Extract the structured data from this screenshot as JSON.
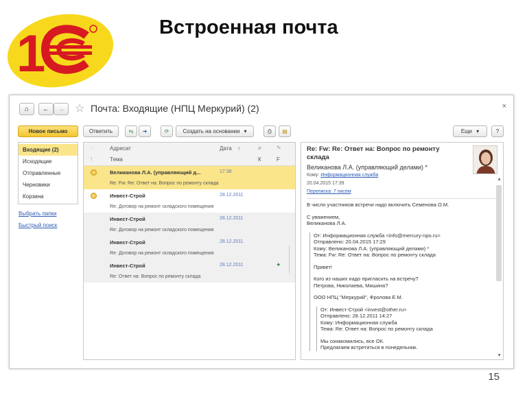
{
  "slide": {
    "title": "Встроенная почта",
    "page_number": "15"
  },
  "window": {
    "title": "Почта: Входящие (НПЦ Меркурий) (2)",
    "nav": [
      "⌂",
      "←",
      "→"
    ],
    "close": "×"
  },
  "toolbar": {
    "new_message": "Новое письмо",
    "reply": "Ответить",
    "create_based_on": "Создать на основании",
    "more": "Еще",
    "help": "?"
  },
  "sidebar": {
    "folders": [
      {
        "label": "Входящие (2)",
        "active": true
      },
      {
        "label": "Исходящие",
        "active": false
      },
      {
        "label": "Отправленные",
        "active": false
      },
      {
        "label": "Черновики",
        "active": false
      },
      {
        "label": "Корзина",
        "active": false
      }
    ],
    "select_folders": "Выбрать папки",
    "quick_search": "Быстрый поиск"
  },
  "list": {
    "headers": {
      "addressee": "Адресат",
      "date": "Дата",
      "sort_arrow": "↑",
      "subject": "Тема",
      "k": "К",
      "flag_col": "F"
    },
    "rows": [
      {
        "sender": "Великанова Л.А. (управляющий д...",
        "date": "17:38",
        "subject": "Re: Fw: Re: Ответ на: Вопрос по ремонту склада",
        "state": "selected",
        "dot": true,
        "flag": ""
      },
      {
        "sender": "Инвест-Строй",
        "date": "28.12.2011",
        "subject": "Re: Договор на ремонт складского помещения",
        "state": "unread",
        "dot": true,
        "flag": ""
      },
      {
        "sender": "Инвест-Строй",
        "date": "28.12.2011",
        "subject": "Re: Договор на ремонт складского помещения",
        "state": "read",
        "dot": false,
        "flag": ""
      },
      {
        "sender": "Инвест-Строй",
        "date": "28.12.2011",
        "subject": "Re: Договор на ремонт складского помещения",
        "state": "read",
        "dot": false,
        "flag": ""
      },
      {
        "sender": "Инвест-Строй",
        "date": "28.12.2011",
        "subject": "Re: Ответ на: Вопрос по ремонту склада",
        "state": "read",
        "dot": false,
        "flag": "✦"
      }
    ]
  },
  "reader": {
    "subject": "Re: Fw: Re: Ответ на: Вопрос по ремонту склада",
    "from": "Великанова Л.А. (управляющий делами) *",
    "to_label": "Кому:",
    "to_value": "Информационная служба",
    "date": "20.04.2015 17:39",
    "thread": "Переписка: 7 писем",
    "body": [
      "В число участников встречи надо включить Семенова О.М.",
      "С уважением,\nВеликанова Л.А."
    ],
    "quote1": [
      "От: Информационная служба <info@mercury-npo.ru>\nОтправлено: 20.04.2015 17:29\nКому: Великанова Л.А. (управляющий делами) *\nТема: Fw: Re: Ответ на: Вопрос по ремонту склада",
      "Привет!",
      "Кого из наших надо пригласить на встречу?\nПетрова, Николаева, Мишина?",
      "ООО НПЦ \"Меркурий\", Фролова Е.М."
    ],
    "quote2": [
      "От: Инвест-Строй <invest@other.ru>\nОтправлено: 28.12.2011 14:27\nКому: Информационная служба\nТема: Re: Ответ на: Вопрос по ремонту склада",
      "Мы ознакомились, все ОК.\nПредлагаем встретиться в понедельник."
    ]
  },
  "colors": {
    "logo_red": "#d71921",
    "logo_yellow": "#f8d81c",
    "highlight": "#fbe58a",
    "link": "#2a5bb3"
  }
}
